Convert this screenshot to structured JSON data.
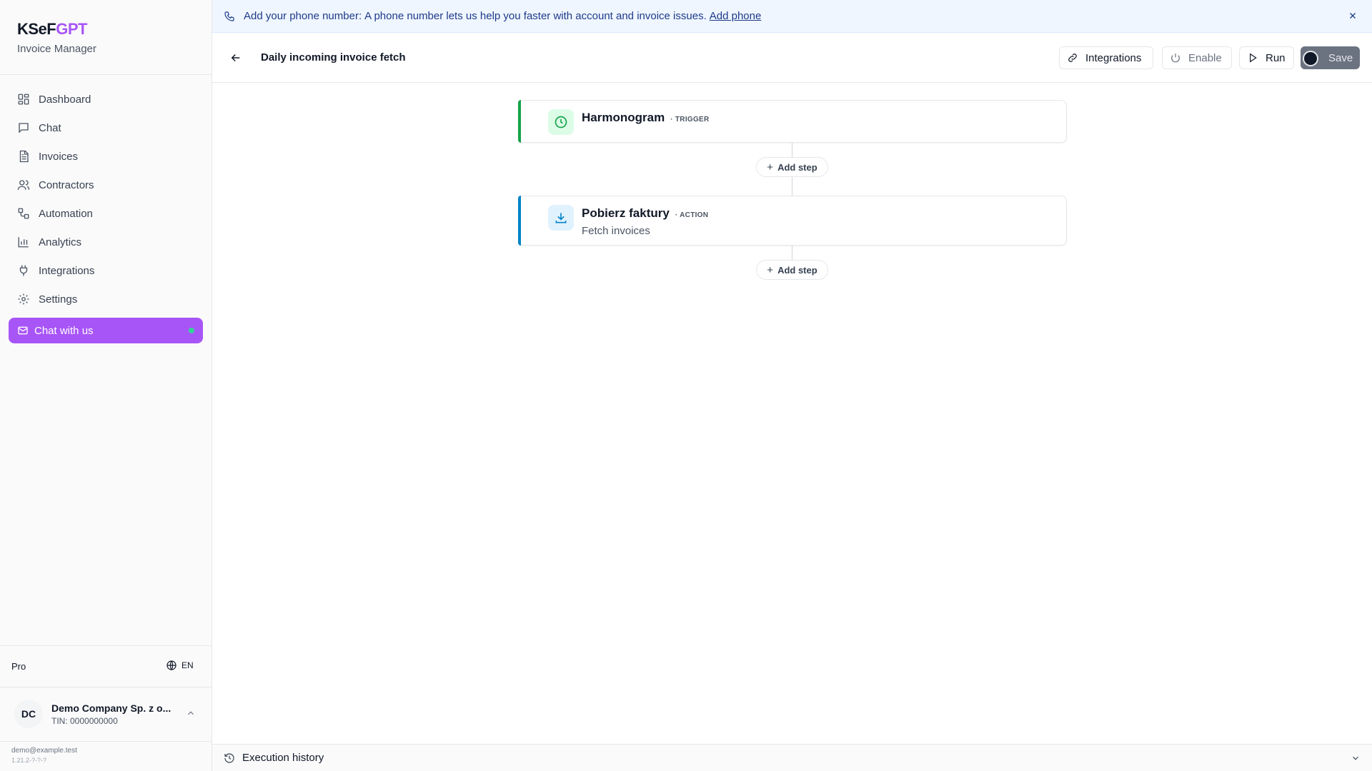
{
  "brand": {
    "name_a": "KSeF",
    "name_b": "GPT",
    "subtitle": "Invoice Manager",
    "accent_color": "#a855f7"
  },
  "nav": {
    "items": [
      {
        "label": "Dashboard",
        "icon": "dashboard-icon"
      },
      {
        "label": "Chat",
        "icon": "chat-icon"
      },
      {
        "label": "Invoices",
        "icon": "invoice-icon"
      },
      {
        "label": "Contractors",
        "icon": "users-icon"
      },
      {
        "label": "Automation",
        "icon": "workflow-icon"
      },
      {
        "label": "Analytics",
        "icon": "bar-chart-icon"
      },
      {
        "label": "Integrations",
        "icon": "plug-icon"
      },
      {
        "label": "Settings",
        "icon": "gear-icon"
      }
    ],
    "chat_with_us": "Chat with us"
  },
  "account": {
    "plan": "Pro",
    "language": "EN",
    "company_initials": "DC",
    "company_name": "Demo Company Sp. z o...",
    "company_tin": "TIN: 0000000000",
    "email": "demo@example.test",
    "version": "1.21.2-?-?-?"
  },
  "banner": {
    "label": "Add your phone number:",
    "message": "A phone number lets us help you faster with account and invoice issues.",
    "link": "Add phone"
  },
  "header": {
    "title": "Daily incoming invoice fetch",
    "integrations_label": "Integrations",
    "enable_label": "Enable",
    "run_label": "Run",
    "save_label": "Save"
  },
  "workflow": {
    "trigger": {
      "title": "Harmonogram",
      "type": "· TRIGGER",
      "icon": "clock-icon"
    },
    "action": {
      "title": "Pobierz faktury",
      "type": "· ACTION",
      "description": "Fetch invoices",
      "icon": "download-icon"
    },
    "add_step_label": "Add step"
  },
  "footer": {
    "label": "Execution history"
  }
}
